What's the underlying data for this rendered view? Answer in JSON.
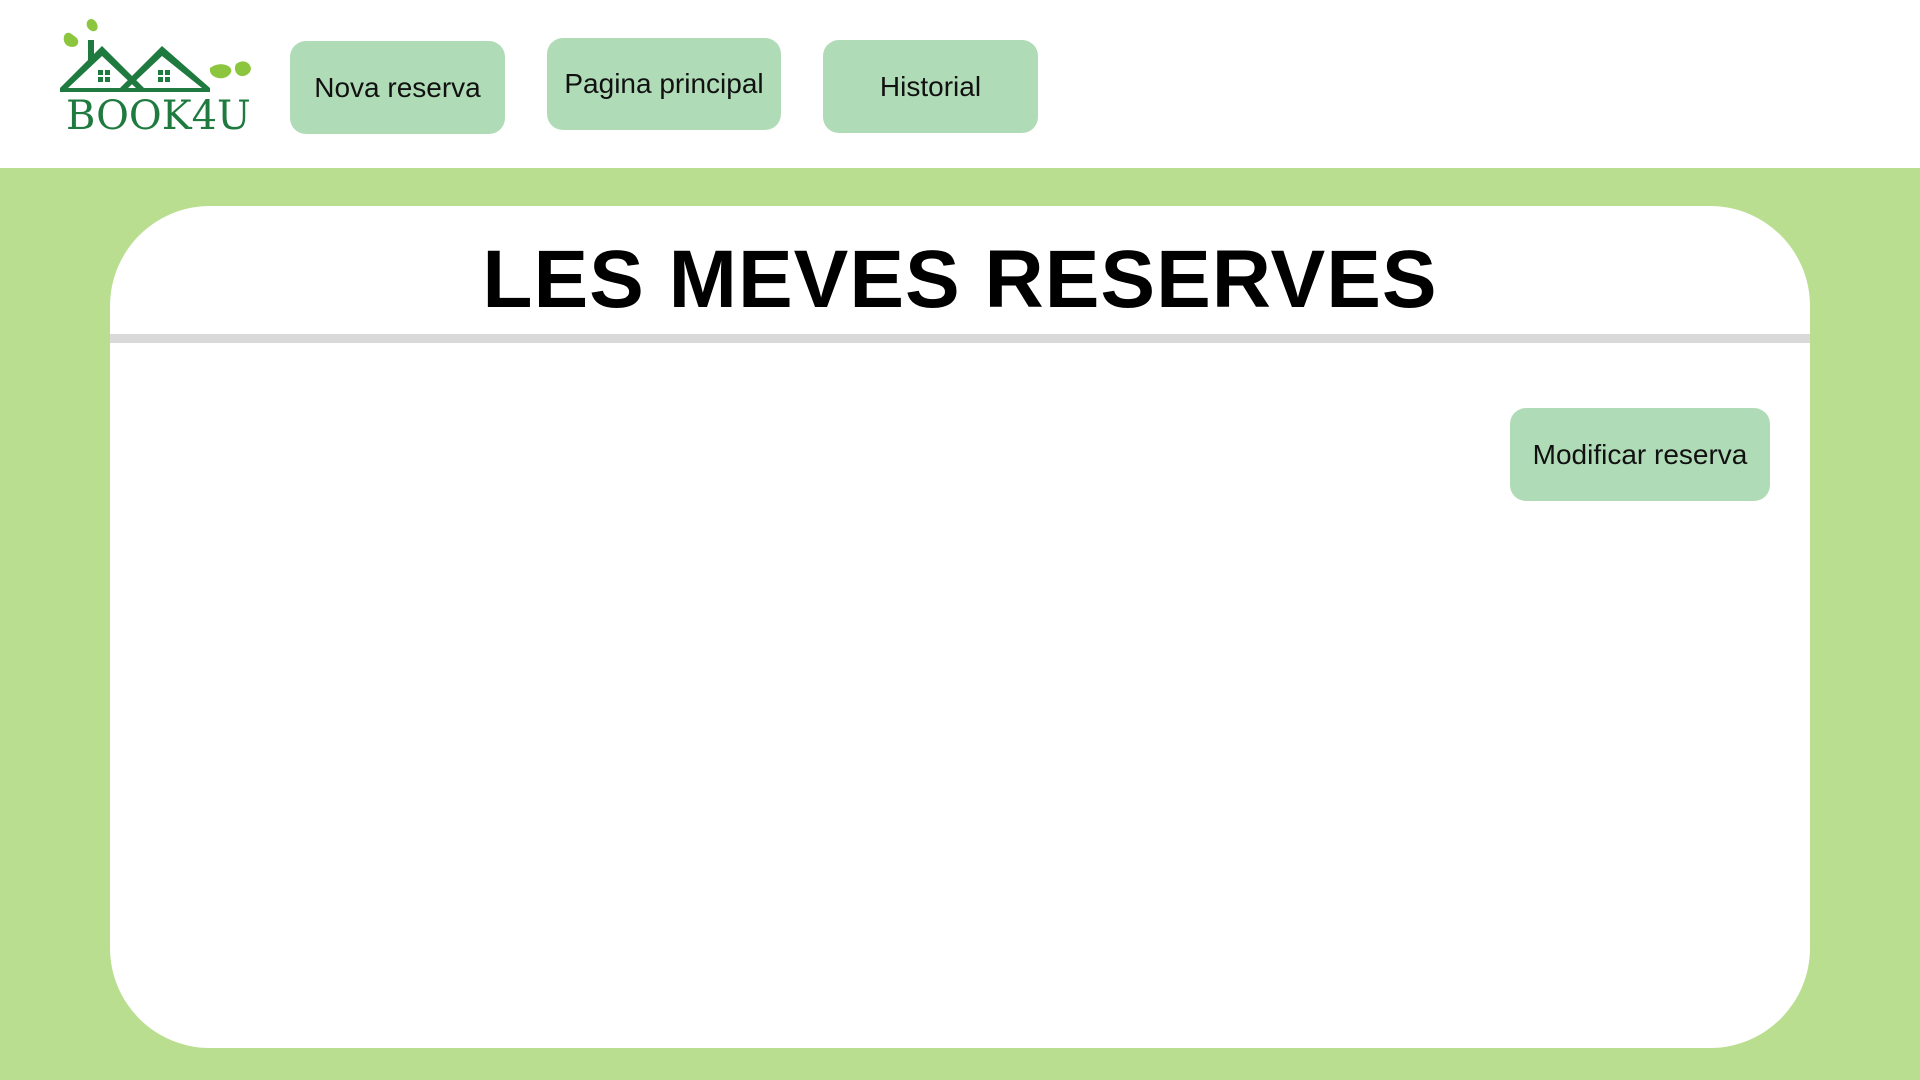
{
  "brand": {
    "name": "BOOK4U",
    "primary_color": "#1e7a3e",
    "leaf_color": "#8cc63f"
  },
  "nav": {
    "nova_reserva": "Nova reserva",
    "pagina_principal": "Pagina principal",
    "historial": "Historial"
  },
  "main": {
    "title": "LES MEVES RESERVES",
    "modify_button": "Modificar reserva"
  },
  "colors": {
    "button_bg": "#b0dbb7",
    "page_bg": "#b9de8f",
    "divider": "#d9d9d9"
  }
}
